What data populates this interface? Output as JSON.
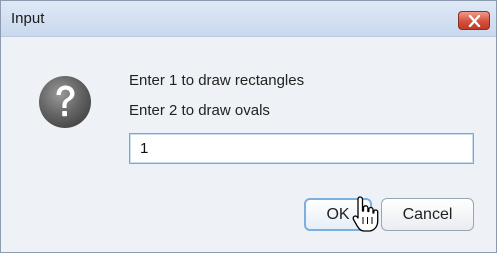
{
  "window": {
    "title": "Input",
    "close_icon": "close-x-icon"
  },
  "message": {
    "icon": "question-mark-icon",
    "line1": "Enter 1 to draw rectangles",
    "line2": "Enter 2 to draw ovals"
  },
  "input": {
    "value": "1"
  },
  "buttons": {
    "ok_label": "OK",
    "cancel_label": "Cancel"
  },
  "cursor": {
    "icon": "hand-pointer-icon"
  },
  "colors": {
    "close_button": "#d4513d",
    "focus_border": "#7ab0e0"
  }
}
